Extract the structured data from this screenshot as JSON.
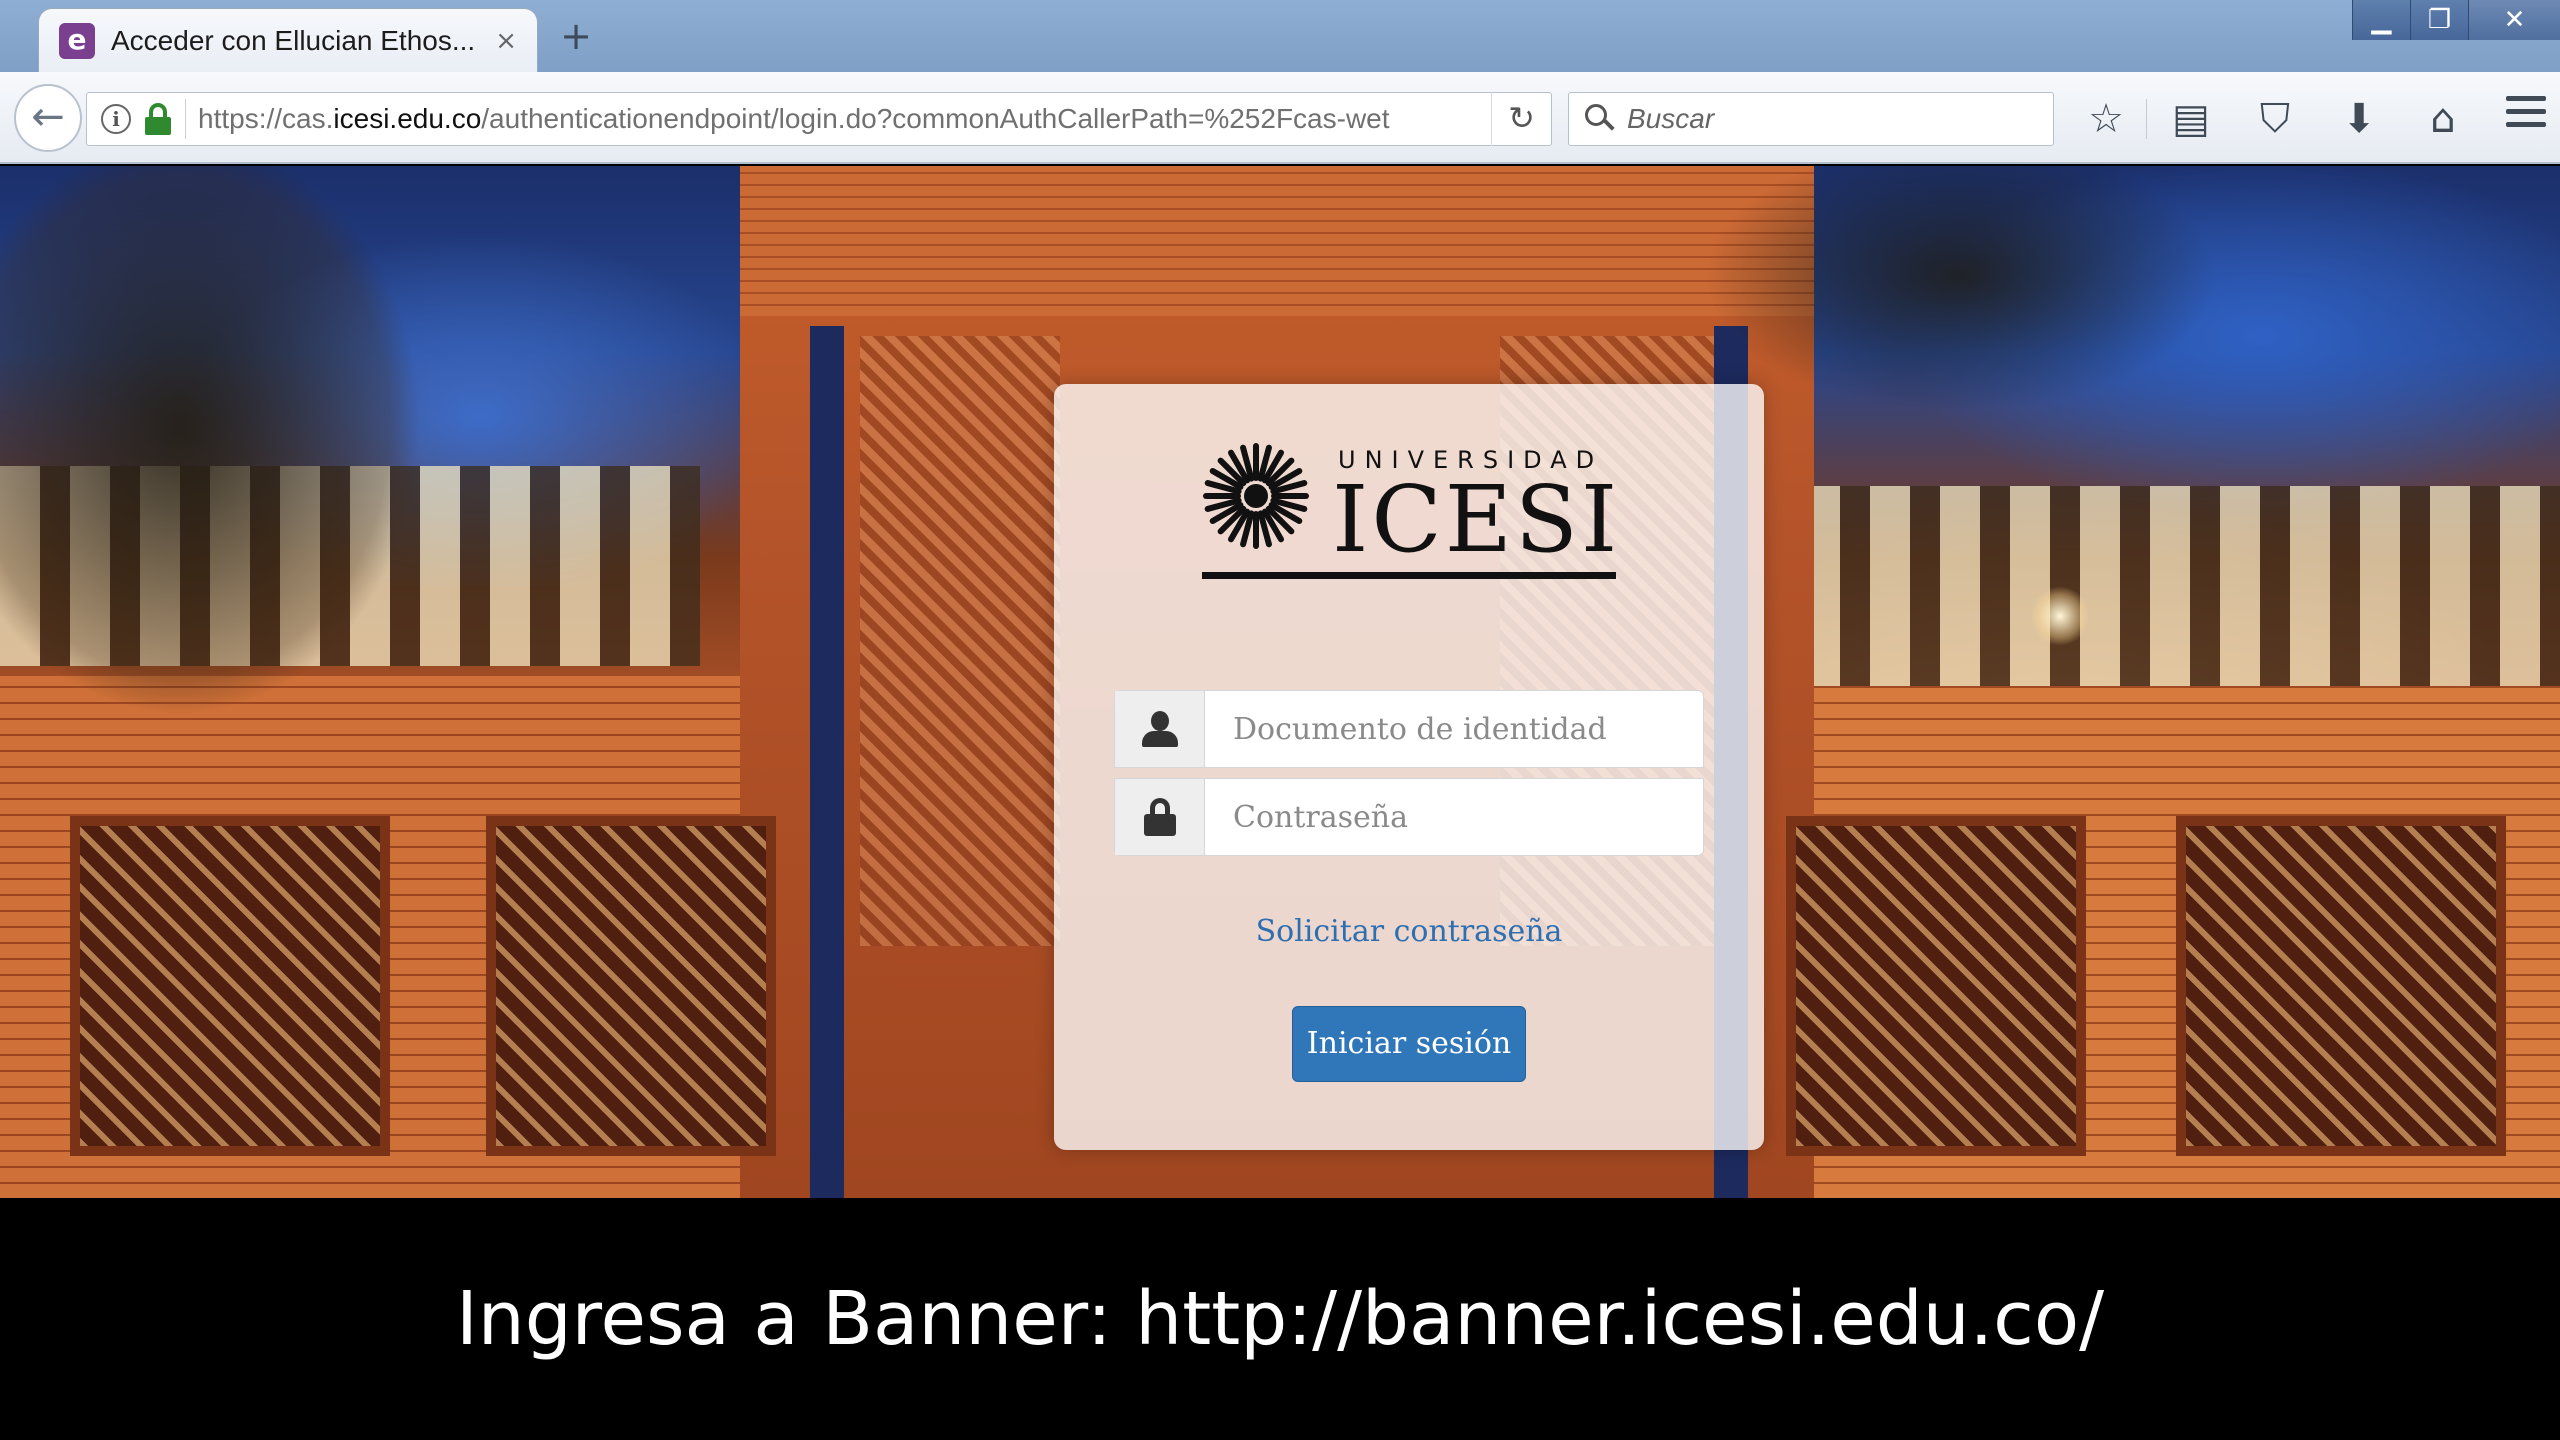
{
  "browser": {
    "tab": {
      "favicon_letter": "e",
      "title": "Acceder con Ellucian Ethos...",
      "close_glyph": "×"
    },
    "new_tab_glyph": "+",
    "window_controls": {
      "minimize": "▁",
      "restore": "❐",
      "close": "✕"
    },
    "back_glyph": "←",
    "url": {
      "prefix": "https://cas.",
      "host": "icesi.edu.co",
      "path": "/authenticationendpoint/login.do?commonAuthCallerPath=%252Fcas-wet"
    },
    "reload_glyph": "↻",
    "search": {
      "placeholder": "Buscar"
    },
    "toolbar": {
      "bookmark_star": "☆",
      "reading_list": "▤",
      "pocket": "⛉",
      "download": "⬇",
      "home": "⌂"
    }
  },
  "login": {
    "logo": {
      "top_text": "UNIVERSIDAD",
      "main_text": "ICESI"
    },
    "username_placeholder": "Documento de identidad",
    "password_placeholder": "Contraseña",
    "forgot_link": "Solicitar contraseña",
    "submit_label": "Iniciar sesión"
  },
  "caption": "Ingresa a Banner: http://banner.icesi.edu.co/",
  "colors": {
    "button": "#2f77b9",
    "link": "#2e6fb2",
    "lock_green": "#2f8a2f",
    "favicon_purple": "#7a3f8f"
  }
}
